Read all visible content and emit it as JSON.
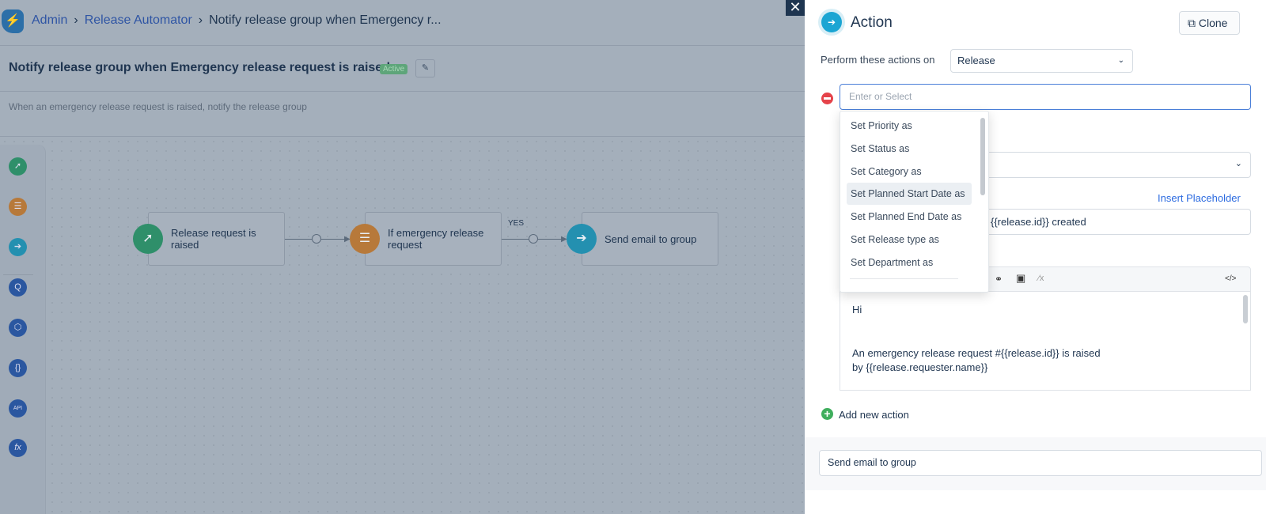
{
  "breadcrumb": {
    "items": [
      "Admin",
      "Release Automator",
      "Notify release group when Emergency r..."
    ]
  },
  "workflow": {
    "title": "Notify release group when Emergency release request is raised",
    "status": "Active",
    "description": "When an emergency release request is raised, notify the release group"
  },
  "toolbox": {
    "icons": [
      "pointer-click-icon",
      "condition-sliders-icon",
      "action-arrow-icon",
      "query-icon",
      "box-icon",
      "code-braces-icon",
      "api-cloud-icon",
      "function-fx-icon"
    ],
    "labels": {
      "api": "API",
      "fx": "fx"
    }
  },
  "flow": {
    "nodes": [
      {
        "label": "Release request is raised",
        "color": "#2f8f6a"
      },
      {
        "label": "If emergency release request",
        "color": "#b7793a"
      },
      {
        "label": "Send email to group",
        "color": "#2490b0"
      }
    ],
    "branch_label": "YES"
  },
  "panel": {
    "title": "Action",
    "clone_label": "Clone",
    "perform_label": "Perform these actions on",
    "perform_value": "Release",
    "action_placeholder": "Enter or Select",
    "dropdown_options": [
      "Set Priority as",
      "Set Status as",
      "Set Category as",
      "Set Planned Start Date as",
      "Set Planned End Date as",
      "Set Release type as",
      "Set Department as"
    ],
    "highlighted_option": "Set Planned Start Date as",
    "insert_placeholder": "Insert Placeholder",
    "subject_value": "{{release.id}} created",
    "body": {
      "line1": "Hi",
      "line2": "An emergency release request #{{release.id}} is raised",
      "line3": "by {{release.requester.name}}"
    },
    "add_action_label": "Add new action",
    "action_name_value": "Send email to group"
  }
}
